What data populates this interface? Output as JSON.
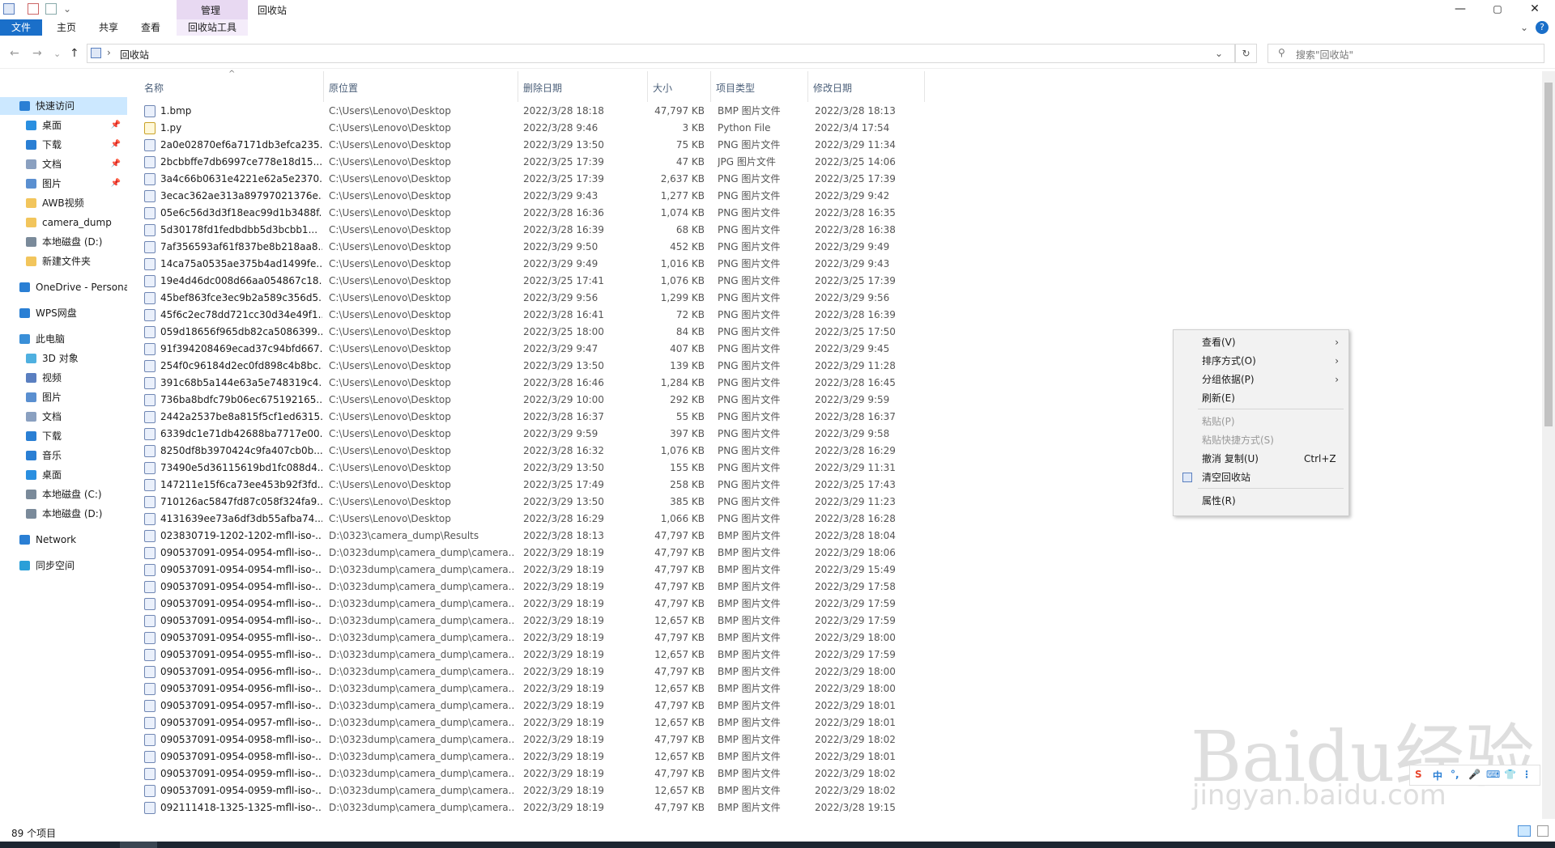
{
  "window": {
    "title": "回收站",
    "ribbon_context_group": "管理",
    "min_glyph": "—",
    "max_glyph": "▢",
    "close_glyph": "✕"
  },
  "ribbon": {
    "tabs": [
      "文件",
      "主页",
      "共享",
      "查看",
      "回收站工具"
    ],
    "expand_glyph": "⌄",
    "help_glyph": "?"
  },
  "address": {
    "back": "←",
    "forward": "→",
    "recent": "⌄",
    "up": "↑",
    "separator": "›",
    "path": "回收站",
    "dropdown": "⌄",
    "refresh": "↻",
    "search_placeholder": "搜索\"回收站\"",
    "search_glyph": "⚲"
  },
  "sidebar": {
    "items": [
      {
        "label": "快速访问",
        "icon": "star-icon",
        "pinned": false
      },
      {
        "label": "桌面",
        "icon": "desktop-icon",
        "pinned": true
      },
      {
        "label": "下载",
        "icon": "download-icon",
        "pinned": true
      },
      {
        "label": "文档",
        "icon": "document-icon",
        "pinned": true
      },
      {
        "label": "图片",
        "icon": "picture-icon",
        "pinned": true
      },
      {
        "label": "AWB视频",
        "icon": "folder-icon",
        "pinned": false
      },
      {
        "label": "camera_dump",
        "icon": "folder-icon",
        "pinned": false
      },
      {
        "label": "本地磁盘 (D:)",
        "icon": "drive-icon",
        "pinned": false
      },
      {
        "label": "新建文件夹",
        "icon": "folder-icon",
        "pinned": false
      },
      {
        "label": "OneDrive - Persona",
        "icon": "cloud-icon",
        "pinned": false
      },
      {
        "label": "WPS网盘",
        "icon": "cloud-icon",
        "pinned": false
      },
      {
        "label": "此电脑",
        "icon": "computer-icon",
        "pinned": false
      },
      {
        "label": "3D 对象",
        "icon": "cube-icon",
        "pinned": false
      },
      {
        "label": "视频",
        "icon": "video-icon",
        "pinned": false
      },
      {
        "label": "图片",
        "icon": "picture-icon",
        "pinned": false
      },
      {
        "label": "文档",
        "icon": "document-icon",
        "pinned": false
      },
      {
        "label": "下载",
        "icon": "download-icon",
        "pinned": false
      },
      {
        "label": "音乐",
        "icon": "music-icon",
        "pinned": false
      },
      {
        "label": "桌面",
        "icon": "desktop-icon",
        "pinned": false
      },
      {
        "label": "本地磁盘 (C:)",
        "icon": "drive-icon",
        "pinned": false
      },
      {
        "label": "本地磁盘 (D:)",
        "icon": "drive-icon",
        "pinned": false
      },
      {
        "label": "Network",
        "icon": "network-icon",
        "pinned": false
      },
      {
        "label": "同步空间",
        "icon": "sync-icon",
        "pinned": false
      }
    ],
    "pin_glyph": "📌"
  },
  "columns": [
    "名称",
    "原位置",
    "删除日期",
    "大小",
    "项目类型",
    "修改日期"
  ],
  "sort_glyph": "^",
  "files": [
    [
      "1.bmp",
      "C:\\Users\\Lenovo\\Desktop",
      "2022/3/28 18:18",
      "47,797 KB",
      "BMP 图片文件",
      "2022/3/28 18:13"
    ],
    [
      "1.py",
      "C:\\Users\\Lenovo\\Desktop",
      "2022/3/28 9:46",
      "3 KB",
      "Python File",
      "2022/3/4 17:54"
    ],
    [
      "2a0e02870ef6a7171db3efca235...",
      "C:\\Users\\Lenovo\\Desktop",
      "2022/3/29 13:50",
      "75 KB",
      "PNG 图片文件",
      "2022/3/29 11:34"
    ],
    [
      "2bcbbffe7db6997ce778e18d15...",
      "C:\\Users\\Lenovo\\Desktop",
      "2022/3/25 17:39",
      "47 KB",
      "JPG 图片文件",
      "2022/3/25 14:06"
    ],
    [
      "3a4c66b0631e4221e62a5e2370...",
      "C:\\Users\\Lenovo\\Desktop",
      "2022/3/25 17:39",
      "2,637 KB",
      "PNG 图片文件",
      "2022/3/25 17:39"
    ],
    [
      "3ecac362ae313a89797021376e...",
      "C:\\Users\\Lenovo\\Desktop",
      "2022/3/29 9:43",
      "1,277 KB",
      "PNG 图片文件",
      "2022/3/29 9:42"
    ],
    [
      "05e6c56d3d3f18eac99d1b3488f...",
      "C:\\Users\\Lenovo\\Desktop",
      "2022/3/28 16:36",
      "1,074 KB",
      "PNG 图片文件",
      "2022/3/28 16:35"
    ],
    [
      "5d30178fd1fedbdbb5d3bcbb1...",
      "C:\\Users\\Lenovo\\Desktop",
      "2022/3/28 16:39",
      "68 KB",
      "PNG 图片文件",
      "2022/3/28 16:38"
    ],
    [
      "7af356593af61f837be8b218aa8...",
      "C:\\Users\\Lenovo\\Desktop",
      "2022/3/29 9:50",
      "452 KB",
      "PNG 图片文件",
      "2022/3/29 9:49"
    ],
    [
      "14ca75a0535ae375b4ad1499fe...",
      "C:\\Users\\Lenovo\\Desktop",
      "2022/3/29 9:49",
      "1,016 KB",
      "PNG 图片文件",
      "2022/3/29 9:43"
    ],
    [
      "19e4d46dc008d66aa054867c18...",
      "C:\\Users\\Lenovo\\Desktop",
      "2022/3/25 17:41",
      "1,076 KB",
      "PNG 图片文件",
      "2022/3/25 17:39"
    ],
    [
      "45bef863fce3ec9b2a589c356d5...",
      "C:\\Users\\Lenovo\\Desktop",
      "2022/3/29 9:56",
      "1,299 KB",
      "PNG 图片文件",
      "2022/3/29 9:56"
    ],
    [
      "45f6c2ec78dd721cc30d34e49f1...",
      "C:\\Users\\Lenovo\\Desktop",
      "2022/3/28 16:41",
      "72 KB",
      "PNG 图片文件",
      "2022/3/28 16:39"
    ],
    [
      "059d18656f965db82ca5086399...",
      "C:\\Users\\Lenovo\\Desktop",
      "2022/3/25 18:00",
      "84 KB",
      "PNG 图片文件",
      "2022/3/25 17:50"
    ],
    [
      "91f394208469ecad37c94bfd667...",
      "C:\\Users\\Lenovo\\Desktop",
      "2022/3/29 9:47",
      "407 KB",
      "PNG 图片文件",
      "2022/3/29 9:45"
    ],
    [
      "254f0c96184d2ec0fd898c4b8bc...",
      "C:\\Users\\Lenovo\\Desktop",
      "2022/3/29 13:50",
      "139 KB",
      "PNG 图片文件",
      "2022/3/29 11:28"
    ],
    [
      "391c68b5a144e63a5e748319c4...",
      "C:\\Users\\Lenovo\\Desktop",
      "2022/3/28 16:46",
      "1,284 KB",
      "PNG 图片文件",
      "2022/3/28 16:45"
    ],
    [
      "736ba8bdfc79b06ec675192165...",
      "C:\\Users\\Lenovo\\Desktop",
      "2022/3/29 10:00",
      "292 KB",
      "PNG 图片文件",
      "2022/3/29 9:59"
    ],
    [
      "2442a2537be8a815f5cf1ed6315...",
      "C:\\Users\\Lenovo\\Desktop",
      "2022/3/28 16:37",
      "55 KB",
      "PNG 图片文件",
      "2022/3/28 16:37"
    ],
    [
      "6339dc1e71db42688ba7717e00...",
      "C:\\Users\\Lenovo\\Desktop",
      "2022/3/29 9:59",
      "397 KB",
      "PNG 图片文件",
      "2022/3/29 9:58"
    ],
    [
      "8250df8b3970424c9fa407cb0b...",
      "C:\\Users\\Lenovo\\Desktop",
      "2022/3/28 16:32",
      "1,076 KB",
      "PNG 图片文件",
      "2022/3/28 16:29"
    ],
    [
      "73490e5d36115619bd1fc088d4...",
      "C:\\Users\\Lenovo\\Desktop",
      "2022/3/29 13:50",
      "155 KB",
      "PNG 图片文件",
      "2022/3/29 11:31"
    ],
    [
      "147211e15f6ca73ee453b92f3fd...",
      "C:\\Users\\Lenovo\\Desktop",
      "2022/3/25 17:49",
      "258 KB",
      "PNG 图片文件",
      "2022/3/25 17:43"
    ],
    [
      "710126ac5847fd87c058f324fa9...",
      "C:\\Users\\Lenovo\\Desktop",
      "2022/3/29 13:50",
      "385 KB",
      "PNG 图片文件",
      "2022/3/29 11:23"
    ],
    [
      "4131639ee73a6df3db55afba74...",
      "C:\\Users\\Lenovo\\Desktop",
      "2022/3/28 16:29",
      "1,066 KB",
      "PNG 图片文件",
      "2022/3/28 16:28"
    ],
    [
      "023830719-1202-1202-mfll-iso-...",
      "D:\\0323\\camera_dump\\Results",
      "2022/3/28 18:13",
      "47,797 KB",
      "BMP 图片文件",
      "2022/3/28 18:04"
    ],
    [
      "090537091-0954-0954-mfll-iso-...",
      "D:\\0323dump\\camera_dump\\camera...",
      "2022/3/29 18:19",
      "47,797 KB",
      "BMP 图片文件",
      "2022/3/29 18:06"
    ],
    [
      "090537091-0954-0954-mfll-iso-...",
      "D:\\0323dump\\camera_dump\\camera...",
      "2022/3/29 18:19",
      "47,797 KB",
      "BMP 图片文件",
      "2022/3/29 15:49"
    ],
    [
      "090537091-0954-0954-mfll-iso-...",
      "D:\\0323dump\\camera_dump\\camera...",
      "2022/3/29 18:19",
      "47,797 KB",
      "BMP 图片文件",
      "2022/3/29 17:58"
    ],
    [
      "090537091-0954-0954-mfll-iso-...",
      "D:\\0323dump\\camera_dump\\camera...",
      "2022/3/29 18:19",
      "47,797 KB",
      "BMP 图片文件",
      "2022/3/29 17:59"
    ],
    [
      "090537091-0954-0954-mfll-iso-...",
      "D:\\0323dump\\camera_dump\\camera...",
      "2022/3/29 18:19",
      "12,657 KB",
      "BMP 图片文件",
      "2022/3/29 17:59"
    ],
    [
      "090537091-0954-0955-mfll-iso-...",
      "D:\\0323dump\\camera_dump\\camera...",
      "2022/3/29 18:19",
      "47,797 KB",
      "BMP 图片文件",
      "2022/3/29 18:00"
    ],
    [
      "090537091-0954-0955-mfll-iso-...",
      "D:\\0323dump\\camera_dump\\camera...",
      "2022/3/29 18:19",
      "12,657 KB",
      "BMP 图片文件",
      "2022/3/29 17:59"
    ],
    [
      "090537091-0954-0956-mfll-iso-...",
      "D:\\0323dump\\camera_dump\\camera...",
      "2022/3/29 18:19",
      "47,797 KB",
      "BMP 图片文件",
      "2022/3/29 18:00"
    ],
    [
      "090537091-0954-0956-mfll-iso-...",
      "D:\\0323dump\\camera_dump\\camera...",
      "2022/3/29 18:19",
      "12,657 KB",
      "BMP 图片文件",
      "2022/3/29 18:00"
    ],
    [
      "090537091-0954-0957-mfll-iso-...",
      "D:\\0323dump\\camera_dump\\camera...",
      "2022/3/29 18:19",
      "47,797 KB",
      "BMP 图片文件",
      "2022/3/29 18:01"
    ],
    [
      "090537091-0954-0957-mfll-iso-...",
      "D:\\0323dump\\camera_dump\\camera...",
      "2022/3/29 18:19",
      "12,657 KB",
      "BMP 图片文件",
      "2022/3/29 18:01"
    ],
    [
      "090537091-0954-0958-mfll-iso-...",
      "D:\\0323dump\\camera_dump\\camera...",
      "2022/3/29 18:19",
      "47,797 KB",
      "BMP 图片文件",
      "2022/3/29 18:02"
    ],
    [
      "090537091-0954-0958-mfll-iso-...",
      "D:\\0323dump\\camera_dump\\camera...",
      "2022/3/29 18:19",
      "12,657 KB",
      "BMP 图片文件",
      "2022/3/29 18:01"
    ],
    [
      "090537091-0954-0959-mfll-iso-...",
      "D:\\0323dump\\camera_dump\\camera...",
      "2022/3/29 18:19",
      "47,797 KB",
      "BMP 图片文件",
      "2022/3/29 18:02"
    ],
    [
      "090537091-0954-0959-mfll-iso-...",
      "D:\\0323dump\\camera_dump\\camera...",
      "2022/3/29 18:19",
      "12,657 KB",
      "BMP 图片文件",
      "2022/3/29 18:02"
    ],
    [
      "092111418-1325-1325-mfll-iso-...",
      "D:\\0323dump\\camera_dump\\camera...",
      "2022/3/29 18:19",
      "47,797 KB",
      "BMP 图片文件",
      "2022/3/28 19:15"
    ]
  ],
  "context_menu": {
    "items": [
      {
        "label": "查看(V)",
        "submenu": true,
        "disabled": false,
        "shortcut": ""
      },
      {
        "label": "排序方式(O)",
        "submenu": true,
        "disabled": false,
        "shortcut": ""
      },
      {
        "label": "分组依据(P)",
        "submenu": true,
        "disabled": false,
        "shortcut": ""
      },
      {
        "label": "刷新(E)",
        "submenu": false,
        "disabled": false,
        "shortcut": ""
      },
      {
        "label": "粘贴(P)",
        "submenu": false,
        "disabled": true,
        "shortcut": ""
      },
      {
        "label": "粘贴快捷方式(S)",
        "submenu": false,
        "disabled": true,
        "shortcut": ""
      },
      {
        "label": "撤消 复制(U)",
        "submenu": false,
        "disabled": false,
        "shortcut": "Ctrl+Z"
      },
      {
        "label": "清空回收站",
        "submenu": false,
        "disabled": false,
        "shortcut": "",
        "icon": "recycle-bin-icon"
      },
      {
        "label": "属性(R)",
        "submenu": false,
        "disabled": false,
        "shortcut": ""
      }
    ],
    "submenu_glyph": "›"
  },
  "status": {
    "item_count": "89 个项目"
  },
  "watermark": {
    "logo": "Baidu经验",
    "url": "jingyan.baidu.com"
  },
  "ime": {
    "items": [
      "S",
      "中",
      "°,",
      "🎤",
      "⌨",
      "👕",
      "⋮"
    ]
  },
  "colors": {
    "accent": "#1a6fc9",
    "ribbon_context": "#e8d9f2",
    "header_text": "#4c607a",
    "selection": "#cce8ff"
  }
}
